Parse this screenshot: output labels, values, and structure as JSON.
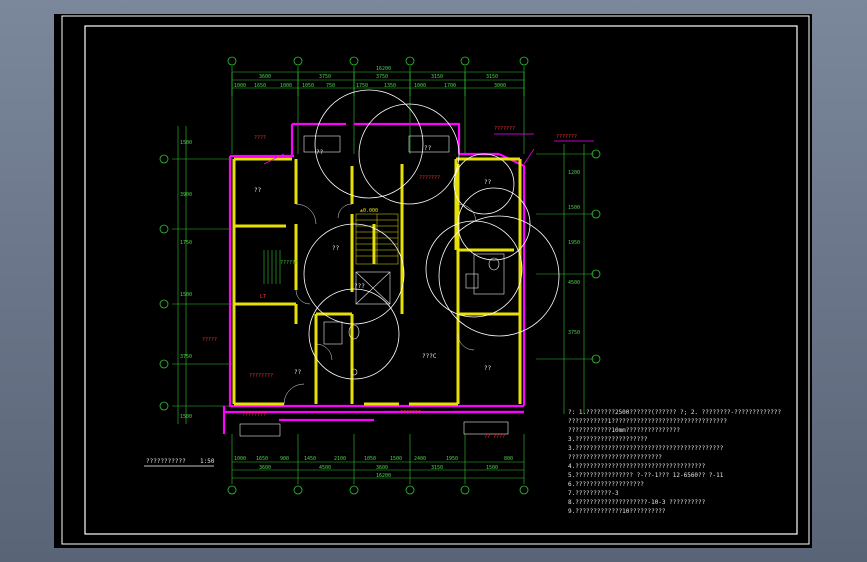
{
  "colors": {
    "background": "#000000",
    "frame": "#ffffff",
    "wall": "#e8e000",
    "outer_wall": "#ff00ff",
    "dimension": "#2ec82e",
    "annotation": "#ff3030",
    "text": "#e8e8e8"
  },
  "dims": {
    "top_total": "16200",
    "top_row1": [
      "3600",
      "3750",
      "3750",
      "3150",
      "3150"
    ],
    "top_row2": [
      "1000",
      "1650",
      "1000",
      "1050",
      "750",
      "1750",
      "1350",
      "1000",
      "1700",
      "3000"
    ],
    "bottom_total": "16200",
    "bottom_row1": [
      "3600",
      "4500",
      "3600",
      "3150",
      "1500"
    ],
    "bottom_row2": [
      "1000",
      "1650",
      "900",
      "1450",
      "2100",
      "1050",
      "1500",
      "2400",
      "1950",
      "800"
    ],
    "left": [
      "1500",
      "3900",
      "1750",
      "1500",
      "3750",
      "1500"
    ],
    "right": [
      "1200",
      "1500",
      "1950",
      "4500",
      "3750"
    ]
  },
  "rooms": {
    "upper_left": "??",
    "upper_right": "??",
    "lower_right": "??",
    "center": "??",
    "balcony_left": "??",
    "balcony_right": "??",
    "stair_label": "???",
    "bedroom_label": "??",
    "elec_box": "?????B"
  },
  "tags": {
    "top_center": "????",
    "top_right_a": "???????",
    "top_right_b": "???????",
    "right_circle": "???????",
    "left_mid": "?????",
    "left_lower": "????????",
    "bottom_left": "????????",
    "bottom_center": "???????",
    "bottom_right": "?? ????",
    "lt": "LT",
    "kt": "???C",
    "floor_mark": "±0.000"
  },
  "plan_title": "???????????",
  "plan_scale": "1:50",
  "notes": [
    "?: 1.????????2500??????(?????? ?; 2.  ????????-?????????????",
    "   ???????????1????????????????????????????????",
    "   ????????????10mm???????????????",
    "   3.????????????????????",
    "3.?????????????????????????????????????????",
    "   ??????????????????????????",
    "4.????????????????????????????????????",
    "5.???????????????? ?-??-1??? 12-6560?? ?-11",
    "6.???????????????????",
    "7.??????????-3",
    "8.????????????????????-10-3      ??????????",
    "9.?????????????10??????????"
  ]
}
